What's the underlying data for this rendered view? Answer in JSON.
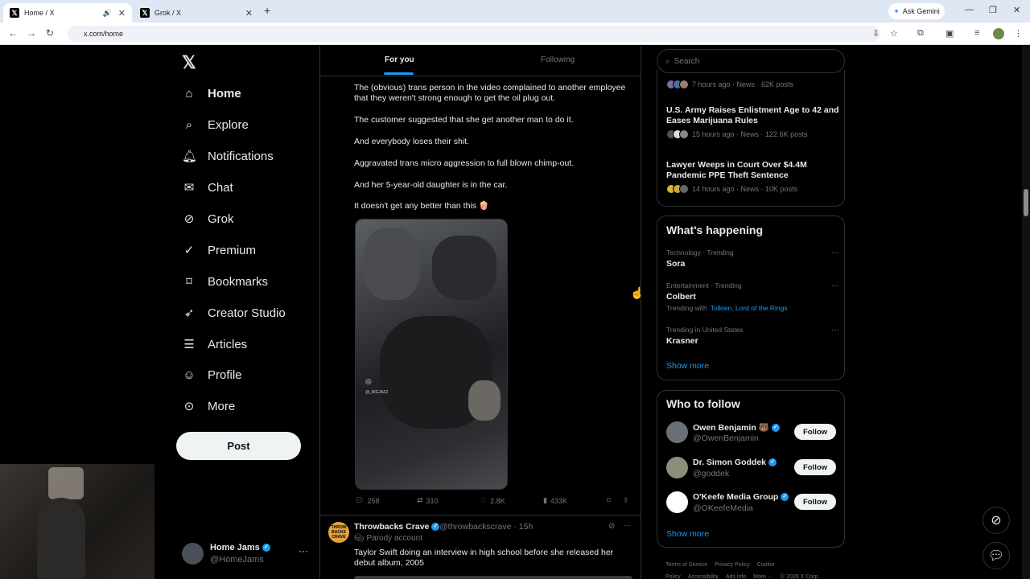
{
  "browser": {
    "tabs": [
      {
        "title": "Home / X",
        "active": true
      },
      {
        "title": "Grok / X",
        "active": false
      }
    ],
    "ask_gemini": "Ask Gemini",
    "url": "x.com/home"
  },
  "nav": {
    "items": [
      {
        "label": "Home",
        "icon": "home-icon"
      },
      {
        "label": "Explore",
        "icon": "search-icon"
      },
      {
        "label": "Notifications",
        "icon": "bell-icon"
      },
      {
        "label": "Chat",
        "icon": "mail-icon"
      },
      {
        "label": "Grok",
        "icon": "grok-icon"
      },
      {
        "label": "Premium",
        "icon": "verified-icon"
      },
      {
        "label": "Bookmarks",
        "icon": "bookmark-icon"
      },
      {
        "label": "Creator Studio",
        "icon": "rocket-icon"
      },
      {
        "label": "Articles",
        "icon": "article-icon"
      },
      {
        "label": "Profile",
        "icon": "person-icon"
      },
      {
        "label": "More",
        "icon": "more-circle-icon"
      }
    ],
    "post_label": "Post",
    "account": {
      "name": "Home Jams",
      "handle": "@HomeJams"
    }
  },
  "feed": {
    "tabs": [
      "For you",
      "Following"
    ],
    "post": {
      "paragraphs": [
        "The (obvious) trans person in the video complained to another employee that they weren't strong enough to get the oil plug out.",
        "The customer suggested that she get another man to do it.",
        "And everybody loses their shit.",
        "Aggravated trans micro aggression to full blown chimp-out.",
        "And her 5-year-old daughter is in the car.",
        "It doesn't get any better than this 🍿"
      ],
      "video_watermark": "@_BIGJAZZ",
      "replies": "258",
      "reposts": "310",
      "likes": "2.8K",
      "views": "433K"
    },
    "next_post": {
      "avatar_text": "THROW BACKS CRAVE",
      "name": "Throwbacks Crave",
      "handle": "@throwbackscrave · 15h",
      "parody": "Parody account",
      "text": "Taylor Swift doing an interview in high school before she released her debut album, 2005"
    }
  },
  "right": {
    "search_placeholder": "Search",
    "news": [
      {
        "title": "",
        "meta": "7 hours ago · News · 62K posts"
      },
      {
        "title": "U.S. Army Raises Enlistment Age to 42 and Eases Marijuana Rules",
        "meta": "15 hours ago · News · 122.6K posts"
      },
      {
        "title": "Lawyer Weeps in Court Over $4.4M Pandemic PPE Theft Sentence",
        "meta": "14 hours ago · News · 10K posts"
      }
    ],
    "happening": {
      "title": "What's happening",
      "trends": [
        {
          "context": "Technology · Trending",
          "name": "Sora",
          "with_label": "",
          "with": ""
        },
        {
          "context": "Entertainment · Trending",
          "name": "Colbert",
          "with_label": "Trending with",
          "with": "Tolkien, Lord of the Rings"
        },
        {
          "context": "Trending in United States",
          "name": "Krasner",
          "with_label": "",
          "with": ""
        }
      ],
      "show_more": "Show more"
    },
    "who_to_follow": {
      "title": "Who to follow",
      "accounts": [
        {
          "name": "Owen Benjamin 🐻",
          "handle": "@OwenBenjamin",
          "button": "Follow",
          "color": "#6b6f78"
        },
        {
          "name": "Dr. Simon Goddek",
          "handle": "@goddek",
          "button": "Follow",
          "color": "#8a8f7a"
        },
        {
          "name": "O'Keefe Media Group",
          "handle": "@OKeefeMedia",
          "button": "Follow",
          "color": "#ffffff"
        }
      ],
      "show_more": "Show more"
    },
    "footer": [
      "Terms of Service",
      "Privacy Policy",
      "Cookie Policy",
      "Accessibility",
      "Ads info",
      "More ···",
      "© 2026 X Corp."
    ]
  },
  "colors": {
    "accent": "#1d9bf0",
    "background": "#000000",
    "border": "#2f3336",
    "muted": "#71767b"
  }
}
